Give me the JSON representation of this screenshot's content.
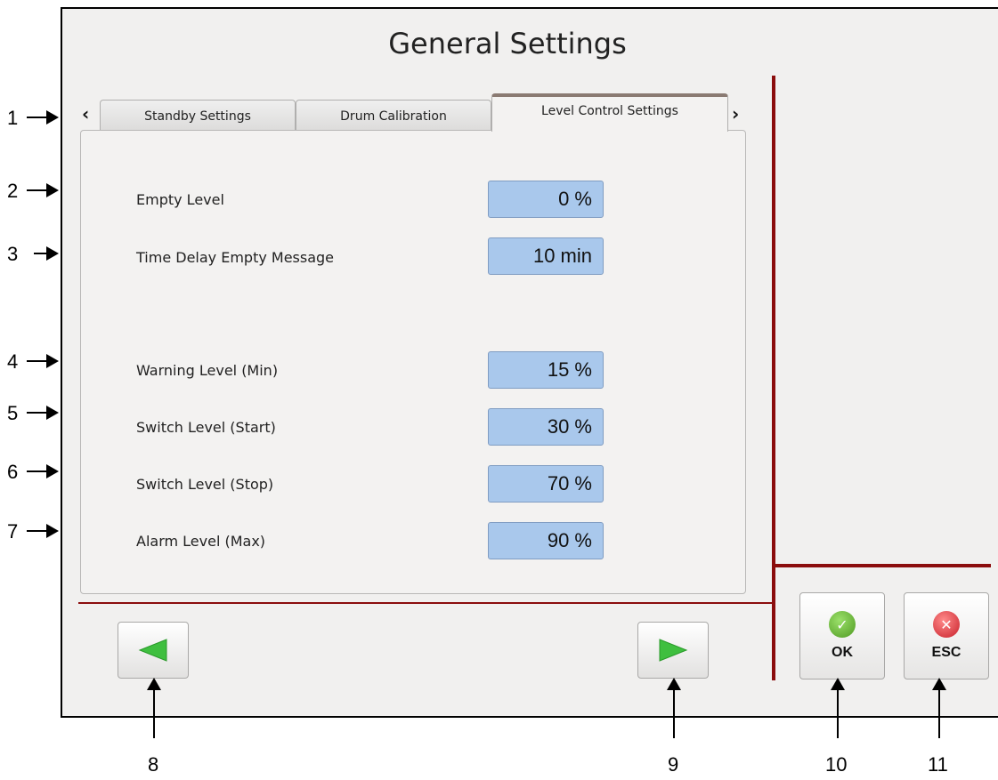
{
  "window": {
    "title": "General Settings"
  },
  "tabs": [
    {
      "label": "Standby Settings",
      "active": false
    },
    {
      "label": "Drum Calibration",
      "active": false
    },
    {
      "label": "Level Control Settings",
      "active": true
    }
  ],
  "tab_scroll": {
    "left": "‹",
    "right": "›"
  },
  "settings": [
    {
      "label": "Empty Level",
      "value": "0 %"
    },
    {
      "label": "Time Delay Empty Message",
      "value": "10 min"
    },
    {
      "label": "Warning Level (Min)",
      "value": "15 %"
    },
    {
      "label": "Switch Level (Start)",
      "value": "30 %"
    },
    {
      "label": "Switch Level (Stop)",
      "value": "70 %"
    },
    {
      "label": "Alarm Level (Max)",
      "value": "90 %"
    }
  ],
  "nav": {
    "prev_icon": "green-left-triangle-icon",
    "next_icon": "green-right-triangle-icon"
  },
  "actions": {
    "ok_label": "OK",
    "esc_label": "ESC",
    "ok_icon": "check-circle-icon",
    "esc_icon": "x-circle-icon"
  },
  "callouts": [
    "1",
    "2",
    "3",
    "4",
    "5",
    "6",
    "7",
    "8",
    "9",
    "10",
    "11"
  ],
  "colors": {
    "accent_line": "#8b0d0d",
    "value_box": "#a9c8ec",
    "ok_green": "#5aaa2c",
    "esc_red": "#d9323a",
    "nav_green": "#3fbf3f"
  }
}
